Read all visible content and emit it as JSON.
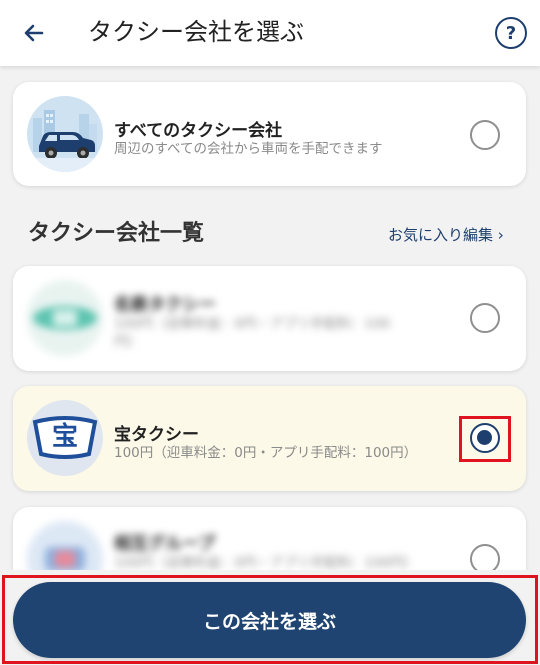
{
  "header": {
    "title": "タクシー会社を選ぶ",
    "help_label": "?"
  },
  "all_option": {
    "name": "すべてのタクシー会社",
    "description": "周辺のすべての会社から車両を手配できます",
    "selected": false
  },
  "section": {
    "title": "タクシー会社一覧",
    "favorites_link": "お気に入り編集 ›"
  },
  "companies": [
    {
      "name": "名鉄タクシー",
      "description": "100円（迎車料金：0円・アプリ手配料：100",
      "description_line2": "円）",
      "blurred": true,
      "selected": false
    },
    {
      "name": "宝タクシー",
      "description": "100円（迎車料金：0円・アプリ手配料：100円）",
      "logo_text": "宝",
      "blurred": false,
      "selected": true
    },
    {
      "name": "相互グループ",
      "description": "100円（迎車料金：0円・アプリ手配料：100円）",
      "blurred": true,
      "selected": false
    }
  ],
  "cta": {
    "label": "この会社を選ぶ"
  },
  "colors": {
    "brand_navy": "#1f4471",
    "selected_card_bg": "#fcf9e8",
    "highlight_red": "#e0141e"
  }
}
